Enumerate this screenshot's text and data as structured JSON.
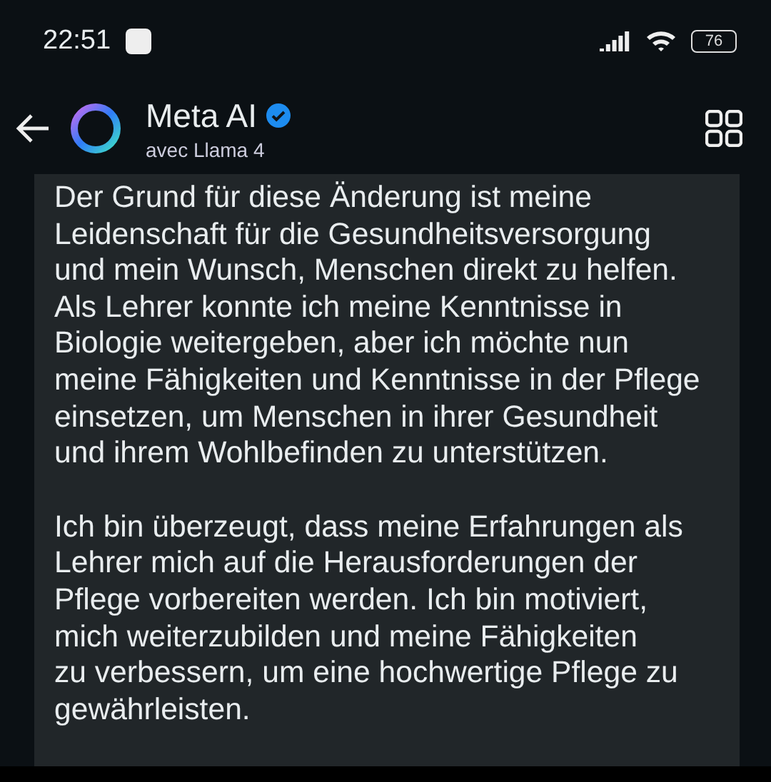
{
  "status_bar": {
    "time": "22:51",
    "battery": "76"
  },
  "header": {
    "title": "Meta AI",
    "verified": true,
    "subtitle": "avec Llama 4"
  },
  "message": {
    "paragraphs": [
      {
        "lines": [
          "Der Grund für diese Änderung ist meine",
          "Leidenschaft für die Gesundheitsversorgung",
          "und mein Wunsch, Menschen direkt zu helfen.",
          "Als Lehrer konnte ich meine Kenntnisse in",
          "Biologie weitergeben, aber ich möchte nun",
          "meine Fähigkeiten und Kenntnisse in der Pflege",
          "einsetzen, um Menschen in ihrer Gesundheit",
          "und ihrem Wohlbefinden zu unterstützen."
        ]
      },
      {
        "lines": [
          "Ich bin überzeugt, dass meine Erfahrungen als",
          "Lehrer mich auf die Herausforderungen der",
          "Pflege vorbereiten werden. Ich bin motiviert,",
          "mich weiterzubilden und meine Fähigkeiten",
          "zu verbessern, um eine hochwertige Pflege zu",
          "gewährleisten."
        ]
      }
    ]
  }
}
